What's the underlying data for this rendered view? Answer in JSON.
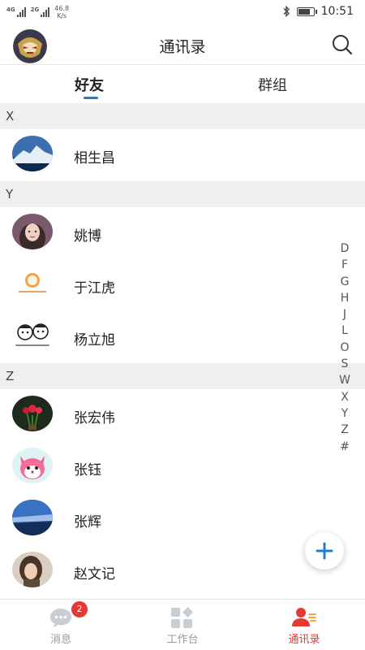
{
  "status_bar": {
    "network_1": "4G",
    "network_2": "2G",
    "speed_value": "46.8",
    "speed_unit": "K/s",
    "time": "10:51",
    "battery_level": 0.8
  },
  "header": {
    "title": "通讯录"
  },
  "tabs": [
    {
      "label": "好友",
      "active": true
    },
    {
      "label": "群组",
      "active": false
    }
  ],
  "sections": [
    {
      "letter": "X",
      "contacts": [
        {
          "name": "相生昌"
        }
      ]
    },
    {
      "letter": "Y",
      "contacts": [
        {
          "name": "姚博"
        },
        {
          "name": "于江虎"
        },
        {
          "name": "杨立旭"
        }
      ]
    },
    {
      "letter": "Z",
      "contacts": [
        {
          "name": "张宏伟"
        },
        {
          "name": "张钰"
        },
        {
          "name": "张辉"
        },
        {
          "name": "赵文记"
        }
      ]
    }
  ],
  "index_letters": [
    "D",
    "F",
    "G",
    "H",
    "J",
    "L",
    "O",
    "S",
    "W",
    "X",
    "Y",
    "Z",
    "#"
  ],
  "bottom_nav": [
    {
      "label": "消息",
      "badge": "2",
      "active": false
    },
    {
      "label": "工作台",
      "active": false
    },
    {
      "label": "通讯录",
      "active": true
    }
  ],
  "colors": {
    "accent_blue": "#1c7cd6",
    "active_red": "#e53935",
    "section_bg": "#eeeff1"
  }
}
